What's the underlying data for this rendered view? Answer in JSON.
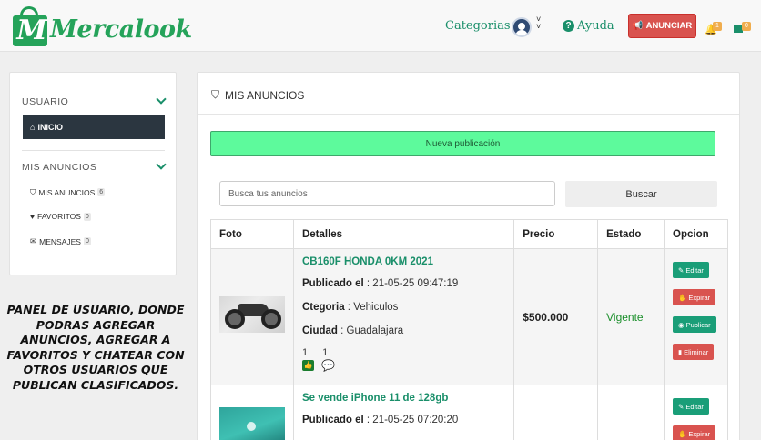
{
  "header": {
    "brand": "Mercalook",
    "categories_label": "Categorias",
    "help_label": "Ayuda",
    "publish_button": "ANUNCIAR",
    "notifications_count": "1",
    "messages_count": "0"
  },
  "sidebar": {
    "user_section": "USUARIO",
    "home_item": "INICIO",
    "ads_section": "MIS ANUNCIOS",
    "items": [
      {
        "label": "MIS ANUNCIOS",
        "count": "6"
      },
      {
        "label": "FAVORITOS",
        "count": "0"
      },
      {
        "label": "MENSAJES",
        "count": "0"
      }
    ]
  },
  "promo_text": "PANEL DE USUARIO, DONDE PODRAS AGREGAR ANUNCIOS, AGREGAR A FAVORITOS Y CHATEAR CON OTROS USUARIOS QUE PUBLICAN CLASIFICADOS.",
  "main": {
    "title": "MIS ANUNCIOS",
    "new_post_button": "Nueva publicación",
    "search": {
      "placeholder": "Busca tus anuncios",
      "value": "",
      "button": "Buscar"
    },
    "columns": [
      "Foto",
      "Detalles",
      "Precio",
      "Estado",
      "Opcion"
    ],
    "rows": [
      {
        "title": "CB160F HONDA 0KM 2021",
        "published_label": "Publicado el",
        "published": "21-05-25 09:47:19",
        "category_label": "Ctegoria",
        "category": "Vehiculos",
        "city_label": "Ciudad",
        "city": "Guadalajara",
        "likes": "1",
        "comments": "1",
        "price": "$500.000",
        "status": "Vigente",
        "actions": [
          "Editar",
          "Expirar",
          "Publicar",
          "Eliminar"
        ]
      },
      {
        "title": "Se vende iPhone 11 de 128gb",
        "published_label": "Publicado el",
        "published": "21-05-25 07:20:20",
        "actions": [
          "Editar",
          "Expirar"
        ]
      }
    ]
  },
  "colors": {
    "brand_green": "#25a35a",
    "accent_teal": "#1a8f6a",
    "danger": "#d9534f",
    "new_post_bg": "#5dfa9c"
  }
}
